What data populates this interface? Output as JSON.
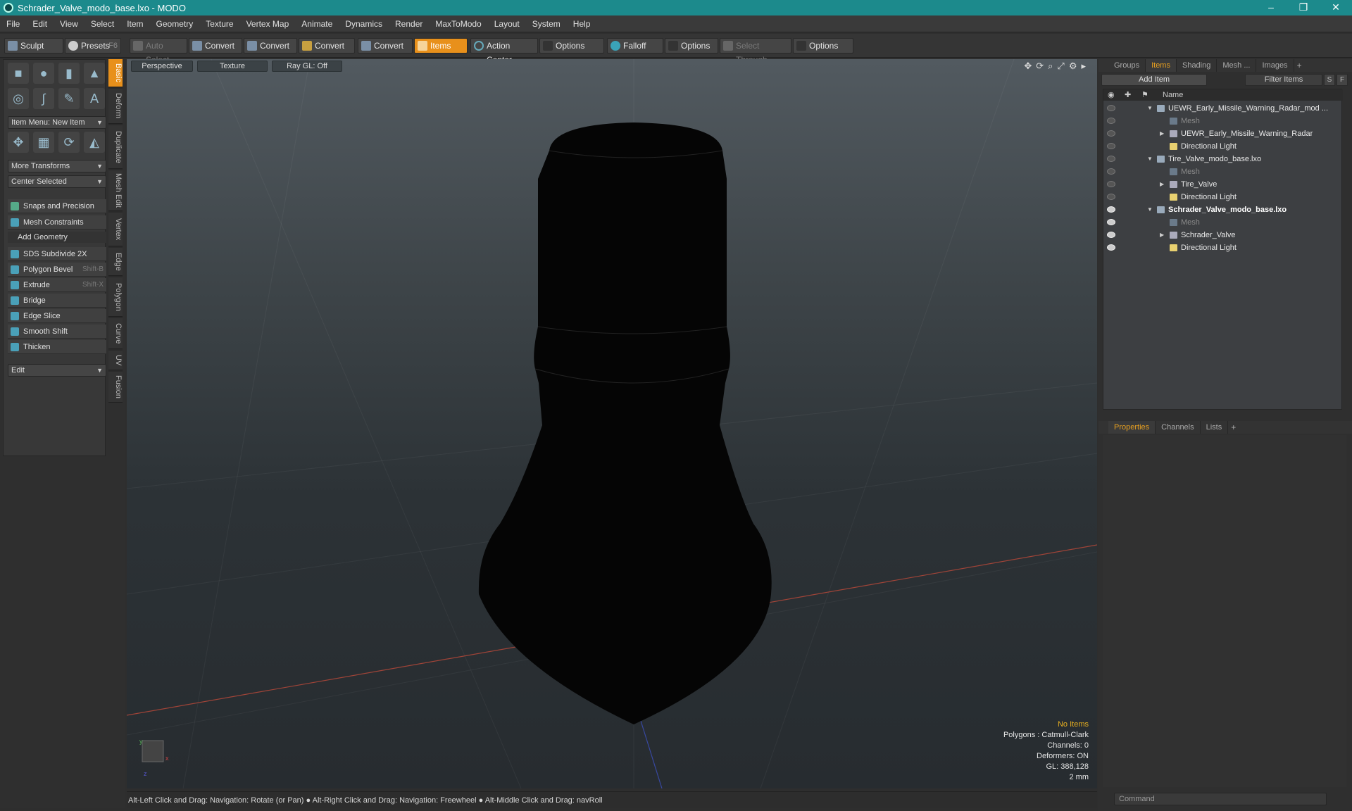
{
  "window": {
    "title": "Schrader_Valve_modo_base.lxo - MODO",
    "minimize": "–",
    "maximize": "❐",
    "close": "✕"
  },
  "menu": [
    "File",
    "Edit",
    "View",
    "Select",
    "Item",
    "Geometry",
    "Texture",
    "Vertex Map",
    "Animate",
    "Dynamics",
    "Render",
    "MaxToModo",
    "Layout",
    "System",
    "Help"
  ],
  "toolbar": {
    "sculpt": "Sculpt",
    "presets": "Presets",
    "presets_key": "F6",
    "auto_select": "Auto Select",
    "convert1": "Convert",
    "convert2": "Convert",
    "convert3": "Convert",
    "convert4": "Convert",
    "items": "Items",
    "action_center": "Action Center",
    "options1": "Options",
    "falloff": "Falloff",
    "options2": "Options",
    "select_through": "Select Through",
    "options3": "Options"
  },
  "left": {
    "item_menu": "Item Menu: New Item",
    "more_transforms": "More Transforms",
    "center_selected": "Center Selected",
    "snaps": "Snaps and Precision",
    "mesh_constraints": "Mesh Constraints",
    "add_geometry": "Add Geometry",
    "tools": [
      {
        "label": "SDS Subdivide 2X",
        "key": ""
      },
      {
        "label": "Polygon Bevel",
        "key": "Shift-B"
      },
      {
        "label": "Extrude",
        "key": "Shift-X"
      },
      {
        "label": "Bridge",
        "key": ""
      },
      {
        "label": "Edge Slice",
        "key": ""
      },
      {
        "label": "Smooth Shift",
        "key": ""
      },
      {
        "label": "Thicken",
        "key": ""
      }
    ],
    "edit": "Edit",
    "vtabs": [
      "Basic",
      "Deform",
      "Duplicate",
      "Mesh Edit",
      "Vertex",
      "Edge",
      "Polygon",
      "Curve",
      "UV",
      "Fusion"
    ]
  },
  "viewport": {
    "perspective": "Perspective",
    "texture": "Texture",
    "raygl": "Ray GL: Off",
    "info": {
      "no_items": "No Items",
      "polygons": "Polygons : Catmull-Clark",
      "channels": "Channels: 0",
      "deformers": "Deformers: ON",
      "gl": "GL: 388,128",
      "scale": "2 mm"
    }
  },
  "statusbar": {
    "hint1": "Alt-Left Click and Drag: Navigation: Rotate (or Pan)",
    "hint2": "Alt-Right Click and Drag: Navigation: Freewheel",
    "hint3": "Alt-Middle Click and Drag: navRoll"
  },
  "right": {
    "tabs": [
      "Groups",
      "Items",
      "Shading",
      "Mesh ...",
      "Images"
    ],
    "add_item": "Add Item",
    "filter": "Filter Items",
    "s_btn": "S",
    "f_btn": "F",
    "name_col": "Name",
    "tree": [
      {
        "label": "UEWR_Early_Missile_Warning_Radar_mod ...",
        "level": 0,
        "type": "scene"
      },
      {
        "label": "Mesh",
        "level": 1,
        "type": "mesh"
      },
      {
        "label": "UEWR_Early_Missile_Warning_Radar",
        "level": 1,
        "type": "group"
      },
      {
        "label": "Directional Light",
        "level": 1,
        "type": "light"
      },
      {
        "label": "Tire_Valve_modo_base.lxo",
        "level": 0,
        "type": "scene"
      },
      {
        "label": "Mesh",
        "level": 1,
        "type": "mesh"
      },
      {
        "label": "Tire_Valve",
        "level": 1,
        "type": "group"
      },
      {
        "label": "Directional Light",
        "level": 1,
        "type": "light"
      },
      {
        "label": "Schrader_Valve_modo_base.lxo",
        "level": 0,
        "type": "scene-active"
      },
      {
        "label": "Mesh",
        "level": 1,
        "type": "mesh"
      },
      {
        "label": "Schrader_Valve",
        "level": 1,
        "type": "group"
      },
      {
        "label": "Directional Light",
        "level": 1,
        "type": "light"
      }
    ],
    "props_tabs": [
      "Properties",
      "Channels",
      "Lists"
    ],
    "command": "Command"
  }
}
